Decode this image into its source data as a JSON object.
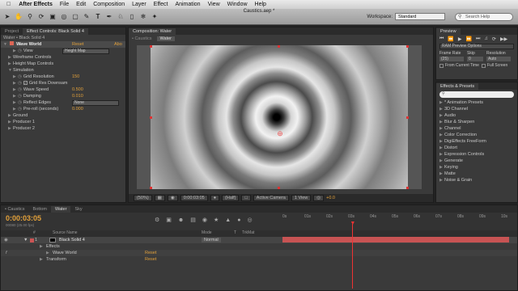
{
  "menubar": {
    "apple": "",
    "app": "After Effects",
    "items": [
      "File",
      "Edit",
      "Composition",
      "Layer",
      "Effect",
      "Animation",
      "View",
      "Window",
      "Help"
    ]
  },
  "doc_title": "Caustics.aep *",
  "toolbar": {
    "workspace_label": "Workspace:",
    "workspace_value": "Standard",
    "search_placeholder": "Search Help"
  },
  "left_panel": {
    "tabs": [
      "Project",
      "Effect Controls: Black Solid 4"
    ],
    "breadcrumb": "Water • Black Solid 4",
    "effect_name": "Wave World",
    "effect_reset": "Reset",
    "effect_about": "Abo",
    "rows": [
      {
        "label": "View",
        "indent": 2,
        "dropdown": "Height Map"
      },
      {
        "label": "Wireframe Controls",
        "indent": 1
      },
      {
        "label": "Height Map Controls",
        "indent": 1
      },
      {
        "label": "Simulation",
        "indent": 1,
        "open": true
      },
      {
        "label": "Grid Resolution",
        "indent": 2,
        "value": "150"
      },
      {
        "label": "Grid Res Downsam",
        "indent": 2,
        "checkbox": true
      },
      {
        "label": "Wave Speed",
        "indent": 2,
        "value": "0.500"
      },
      {
        "label": "Damping",
        "indent": 2,
        "value": "0.010"
      },
      {
        "label": "Reflect Edges",
        "indent": 2,
        "dropdown": "None"
      },
      {
        "label": "Pre-roll (seconds)",
        "indent": 2,
        "value": "0.000"
      },
      {
        "label": "Ground",
        "indent": 1
      },
      {
        "label": "Producer 1",
        "indent": 1
      },
      {
        "label": "Producer 2",
        "indent": 1
      }
    ]
  },
  "comp_panel": {
    "tab": "Composition: Water",
    "crumbs": [
      "• Caustics",
      "Water"
    ],
    "bottom": {
      "zoom": "(50%)",
      "timecode": "0:00:03:05",
      "resolution": "(Half)",
      "camera": "Active Camera",
      "views": "1 View",
      "exposure": "+0.0"
    }
  },
  "preview_panel": {
    "title": "Preview",
    "ram_options": "RAM Preview Options",
    "labels": [
      "Frame Rate",
      "Skip",
      "Resolution"
    ],
    "values": [
      "(25)",
      "0",
      "Auto"
    ],
    "from_current": "From Current Time",
    "full_screen": "Full Screen"
  },
  "effects_panel": {
    "title": "Effects & Presets",
    "search_placeholder": "",
    "items": [
      "* Animation Presets",
      "3D Channel",
      "Audio",
      "Blur & Sharpen",
      "Channel",
      "Color Correction",
      "DigiEffects FreeForm",
      "Distort",
      "Expression Controls",
      "Generate",
      "Keying",
      "Matte",
      "Noise & Grain"
    ]
  },
  "timeline": {
    "tabs": [
      "• Caustics",
      "Bottom",
      "Water",
      "Sky"
    ],
    "timecode": "0:00:03:05",
    "frames": "00080 (25.00 fps)",
    "columns": [
      "#",
      "Source Name",
      "Mode",
      "T",
      "TrkMat"
    ],
    "layer": {
      "num": "1",
      "name": "Black Solid 4",
      "mode": "Normal"
    },
    "sub_rows": [
      {
        "label": "Effects",
        "indent": 1
      },
      {
        "label": "Wave World",
        "indent": 2,
        "reset": "Reset"
      },
      {
        "label": "Transform",
        "indent": 1,
        "reset": "Reset"
      }
    ],
    "ruler": [
      "0s",
      "01s",
      "02s",
      "03s",
      "04s",
      "05s",
      "06s",
      "07s",
      "08s",
      "09s",
      "10s"
    ],
    "current_seconds": 3.2,
    "duration_seconds": 10
  },
  "colors": {
    "accent": "#e3a13a",
    "layer_bar": "#c75353",
    "cti": "#ee3333"
  }
}
